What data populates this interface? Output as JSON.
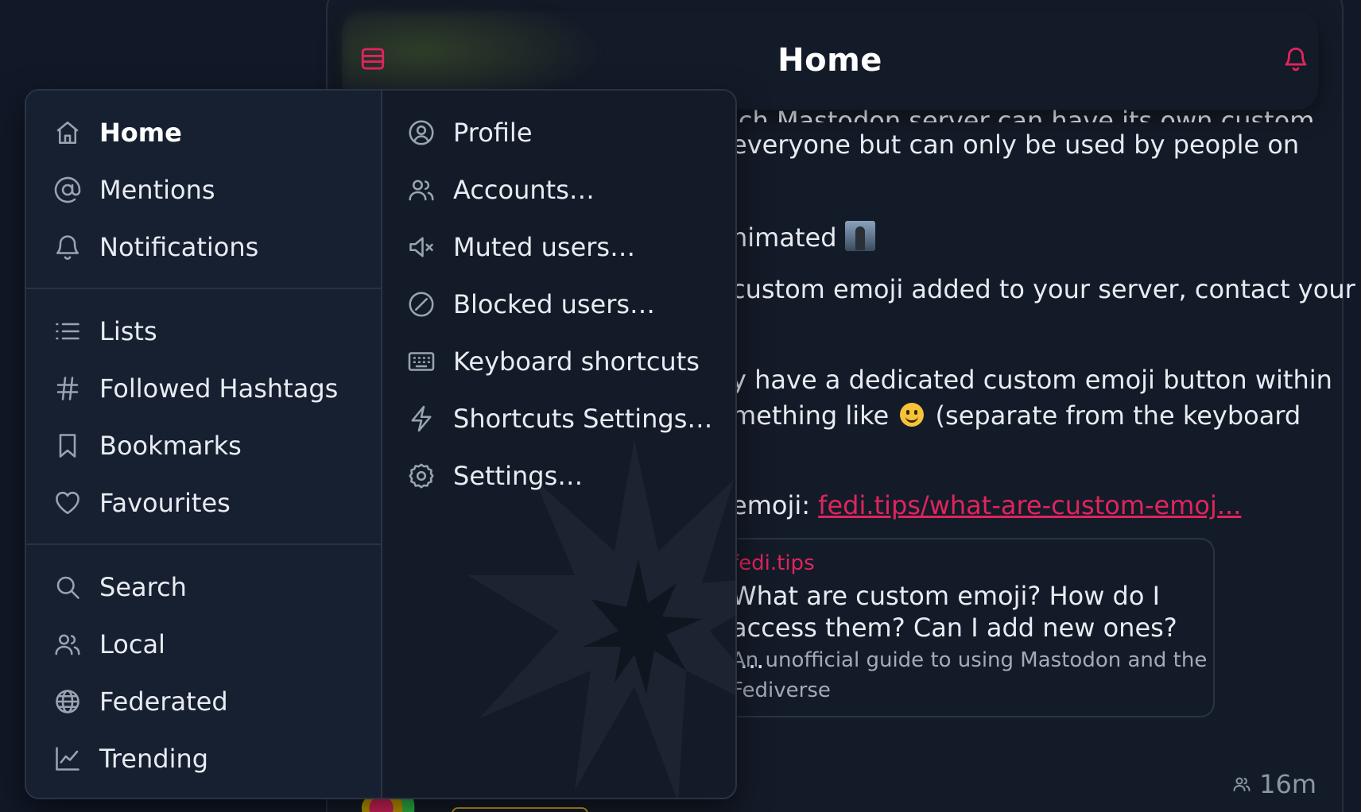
{
  "header": {
    "title": "Home"
  },
  "post": {
    "line_partial_top": "ich Mastodon server can have its own custom",
    "line_1": "everyone but can only be used by people on",
    "line_animated": "nimated",
    "line_contact": "custom emoji added to your server, contact your",
    "line_dedicated": "y have a dedicated custom emoji button within",
    "line_something_a": "mething like",
    "line_something_b": "(separate from the keyboard",
    "line_emoji_prefix": "emoji:",
    "link_text": "fedi.tips/what-are-custom-emoj..."
  },
  "link_card": {
    "domain": "fedi.tips",
    "title": "What are custom emoji? How do I access them? Can I add new ones? |...",
    "description": "An unofficial guide to using Mastodon and the Fediverse"
  },
  "post_meta": {
    "time": "16m",
    "visibility_icon": "people-icon"
  },
  "menu": {
    "left_groups": [
      [
        {
          "label": "Home",
          "icon": "home-icon",
          "active": true
        },
        {
          "label": "Mentions",
          "icon": "at-icon"
        },
        {
          "label": "Notifications",
          "icon": "bell-icon"
        }
      ],
      [
        {
          "label": "Lists",
          "icon": "list-icon"
        },
        {
          "label": "Followed Hashtags",
          "icon": "hashtag-icon"
        },
        {
          "label": "Bookmarks",
          "icon": "bookmark-icon"
        },
        {
          "label": "Favourites",
          "icon": "heart-icon"
        }
      ],
      [
        {
          "label": "Search",
          "icon": "search-icon"
        },
        {
          "label": "Local",
          "icon": "people-icon"
        },
        {
          "label": "Federated",
          "icon": "globe-icon"
        },
        {
          "label": "Trending",
          "icon": "chart-icon"
        }
      ]
    ],
    "right_items": [
      {
        "label": "Profile",
        "icon": "profile-icon"
      },
      {
        "label": "Accounts…",
        "icon": "accounts-icon"
      },
      {
        "label": "Muted users…",
        "icon": "mute-icon"
      },
      {
        "label": "Blocked users…",
        "icon": "block-icon"
      },
      {
        "label": "Keyboard shortcuts",
        "icon": "keyboard-icon"
      },
      {
        "label": "Shortcuts Settings…",
        "icon": "bolt-icon"
      },
      {
        "label": "Settings…",
        "icon": "gear-icon"
      }
    ]
  },
  "colors": {
    "accent": "#e0245e",
    "background": "#111827",
    "panel": "#141b28",
    "text": "#e8ecf2"
  }
}
